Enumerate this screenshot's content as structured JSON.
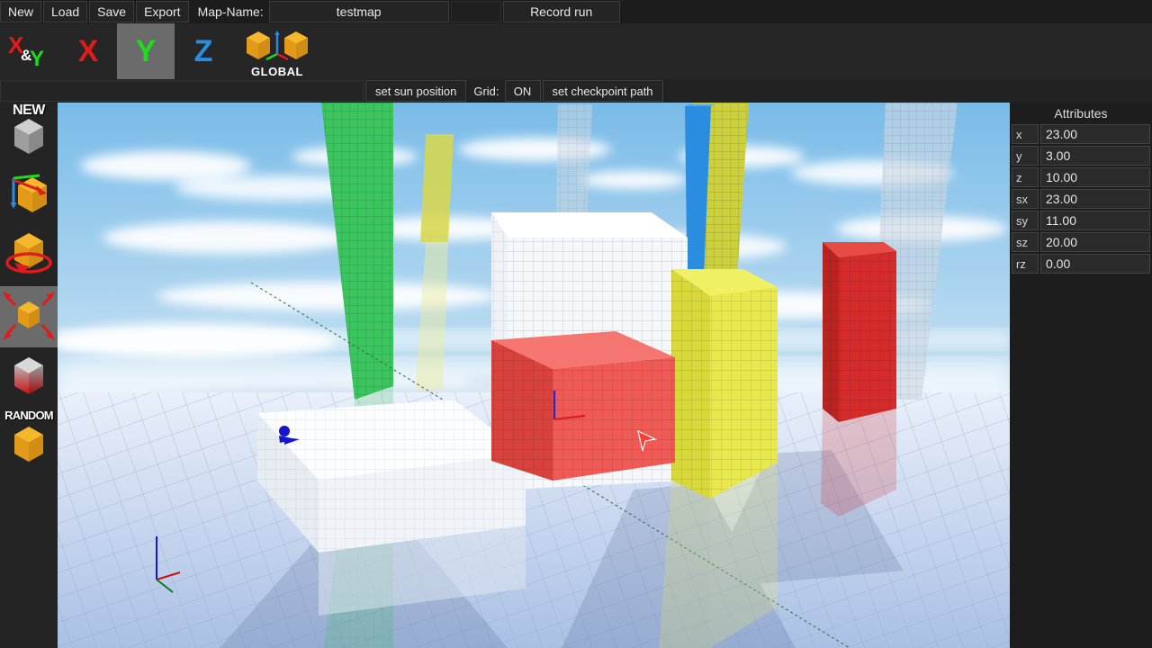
{
  "menu": {
    "buttons": [
      {
        "id": "new",
        "label": "New"
      },
      {
        "id": "load",
        "label": "Load"
      },
      {
        "id": "save",
        "label": "Save"
      },
      {
        "id": "export",
        "label": "Export"
      }
    ],
    "map_name_label": "Map-Name:",
    "map_name_value": "testmap",
    "record_run_label": "Record run"
  },
  "axis_bar": {
    "buttons": [
      {
        "id": "xy",
        "label": "X&Y",
        "selected": false
      },
      {
        "id": "x",
        "label": "X",
        "selected": false,
        "color": "#e01b1b"
      },
      {
        "id": "y",
        "label": "Y",
        "selected": true,
        "color": "#1ddc1d"
      },
      {
        "id": "z",
        "label": "Z",
        "selected": false,
        "color": "#2a8de0"
      }
    ],
    "global_label": "GLOBAL"
  },
  "sub_bar": {
    "set_sun_position_label": "set sun position",
    "grid_label": "Grid:",
    "grid_value": "ON",
    "set_checkpoint_path_label": "set checkpoint path"
  },
  "tools": [
    {
      "id": "new-object",
      "caption": "NEW",
      "name": "tool-new-object",
      "selected": false
    },
    {
      "id": "move",
      "caption": "",
      "name": "tool-move",
      "selected": false
    },
    {
      "id": "rotate",
      "caption": "",
      "name": "tool-rotate",
      "selected": false
    },
    {
      "id": "scale",
      "caption": "",
      "name": "tool-scale",
      "selected": true
    },
    {
      "id": "color",
      "caption": "",
      "name": "tool-color",
      "selected": false
    },
    {
      "id": "random",
      "caption": "RANDOM",
      "name": "tool-random",
      "selected": false
    }
  ],
  "attributes": {
    "title": "Attributes",
    "rows": [
      {
        "key": "x",
        "value": "23.00"
      },
      {
        "key": "y",
        "value": "3.00"
      },
      {
        "key": "z",
        "value": "10.00"
      },
      {
        "key": "sx",
        "value": "23.00"
      },
      {
        "key": "sy",
        "value": "11.00"
      },
      {
        "key": "sz",
        "value": "20.00"
      },
      {
        "key": "rz",
        "value": "0.00"
      }
    ]
  },
  "colors": {
    "panel_bg": "#1d1d1d",
    "toolbar_bg": "#262626",
    "button_bg": "#242424",
    "selected_bg": "#6b6b6b",
    "text": "#e8e8e8",
    "axis_x": "#e01b1b",
    "axis_y": "#1ddc1d",
    "axis_z": "#2a8de0",
    "cube_orange": "#eda41c",
    "sky_top": "#7fbce8",
    "sky_horizon": "#eef6fb",
    "ground": "#b8cdea",
    "selected_object": "#f05a54"
  },
  "viewport": {
    "objects": [
      {
        "name": "green-pillar",
        "color": "#3cc45f"
      },
      {
        "name": "yellow-pillar",
        "color": "#d5d13c"
      },
      {
        "name": "blue-pillar",
        "color": "#2a8de0"
      },
      {
        "name": "white-pillar",
        "color": "#d6dee6"
      },
      {
        "name": "white-box",
        "color": "#f2f5f8"
      },
      {
        "name": "red-box",
        "color": "#f05a54",
        "selected": true
      },
      {
        "name": "yellow-box",
        "color": "#e6e63c"
      },
      {
        "name": "red-pillar",
        "color": "#d42b2b"
      },
      {
        "name": "white-platform",
        "color": "#f2f5f8"
      },
      {
        "name": "spawn-marker",
        "color": "#1515cc"
      }
    ]
  }
}
